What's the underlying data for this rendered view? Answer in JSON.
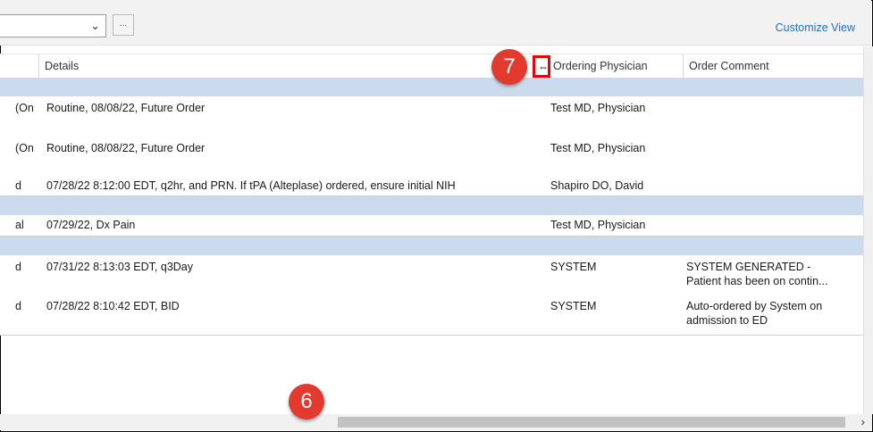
{
  "toolbar": {
    "ellipsis_label": "...",
    "customize_view": "Customize View"
  },
  "columns": {
    "details": "Details",
    "ordering_physician": "Ordering Physician",
    "order_comment": "Order Comment"
  },
  "rows": [
    {
      "prefix": "(On",
      "details": "Routine, 08/08/22, Future Order",
      "physician": "Test MD, Physician",
      "comment1": "",
      "comment2": ""
    },
    {
      "prefix": "(On",
      "details": "Routine, 08/08/22, Future Order",
      "physician": "Test MD, Physician",
      "comment1": "",
      "comment2": ""
    },
    {
      "prefix": "d",
      "details": "07/28/22 8:12:00 EDT, q2hr, and PRN.  If tPA (Alteplase) ordered, ensure initial NIH",
      "physician": "Shapiro DO, David",
      "comment1": "",
      "comment2": ""
    },
    {
      "prefix": "al",
      "details": "07/29/22, Dx Pain",
      "physician": "Test MD, Physician",
      "comment1": "",
      "comment2": ""
    },
    {
      "prefix": "d",
      "details": "07/31/22 8:13:03 EDT, q3Day",
      "physician": "SYSTEM",
      "comment1": "SYSTEM GENERATED -",
      "comment2": "Patient has been on contin..."
    },
    {
      "prefix": "d",
      "details": "07/28/22 8:10:42 EDT, BID",
      "physician": "SYSTEM",
      "comment1": "Auto-ordered by System on",
      "comment2": "admission to ED"
    }
  ],
  "callouts": {
    "seven": "7",
    "six": "6"
  },
  "icons": {
    "dropdown": "chevron-down-icon",
    "resize": "column-resize-icon",
    "scroll_right": "chevron-right-icon"
  },
  "colors": {
    "group_row": "#ccdaee",
    "callout": "#e23a2e",
    "highlight_box": "#e8000b",
    "link": "#1f6fc5"
  }
}
